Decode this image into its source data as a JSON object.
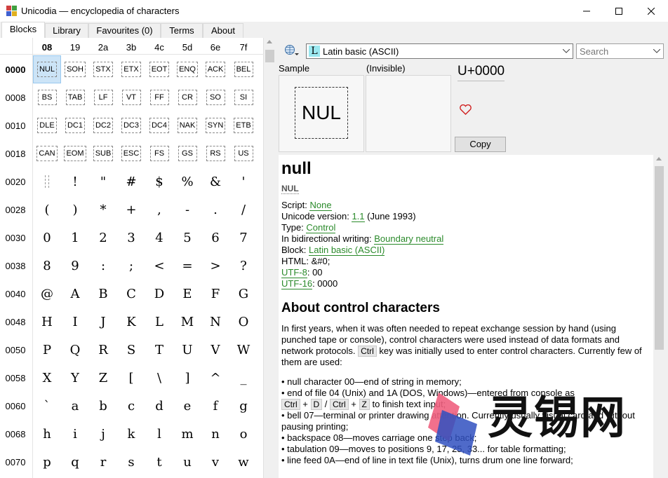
{
  "window": {
    "title": "Unicodia — encyclopedia of characters"
  },
  "tabs": [
    {
      "label": "Blocks",
      "active": true
    },
    {
      "label": "Library"
    },
    {
      "label": "Favourites (0)"
    },
    {
      "label": "Terms"
    },
    {
      "label": "About"
    }
  ],
  "grid": {
    "columns": [
      "08",
      "19",
      "2a",
      "3b",
      "4c",
      "5d",
      "6e",
      "7f"
    ],
    "rows": [
      {
        "label": "0000",
        "cells": [
          "NUL",
          "SOH",
          "STX",
          "ETX",
          "EOT",
          "ENQ",
          "ACK",
          "BEL"
        ],
        "control": true
      },
      {
        "label": "0008",
        "cells": [
          "BS",
          "TAB",
          "LF",
          "VT",
          "FF",
          "CR",
          "SO",
          "SI"
        ],
        "control": true
      },
      {
        "label": "0010",
        "cells": [
          "DLE",
          "DC1",
          "DC2",
          "DC3",
          "DC4",
          "NAK",
          "SYN",
          "ETB"
        ],
        "control": true
      },
      {
        "label": "0018",
        "cells": [
          "CAN",
          "EOM",
          "SUB",
          "ESC",
          "FS",
          "GS",
          "RS",
          "US"
        ],
        "control": true
      },
      {
        "label": "0020",
        "cells": [
          "",
          "!",
          "\"",
          "#",
          "$",
          "%",
          "&",
          "'"
        ]
      },
      {
        "label": "0028",
        "cells": [
          "(",
          ")",
          "*",
          "+",
          ",",
          "-",
          ".",
          "/"
        ]
      },
      {
        "label": "0030",
        "cells": [
          "0",
          "1",
          "2",
          "3",
          "4",
          "5",
          "6",
          "7"
        ]
      },
      {
        "label": "0038",
        "cells": [
          "8",
          "9",
          ":",
          ";",
          "<",
          "=",
          ">",
          "?"
        ]
      },
      {
        "label": "0040",
        "cells": [
          "@",
          "A",
          "B",
          "C",
          "D",
          "E",
          "F",
          "G"
        ]
      },
      {
        "label": "0048",
        "cells": [
          "H",
          "I",
          "J",
          "K",
          "L",
          "M",
          "N",
          "O"
        ]
      },
      {
        "label": "0050",
        "cells": [
          "P",
          "Q",
          "R",
          "S",
          "T",
          "U",
          "V",
          "W"
        ]
      },
      {
        "label": "0058",
        "cells": [
          "X",
          "Y",
          "Z",
          "[",
          "\\",
          "]",
          "^",
          "_"
        ]
      },
      {
        "label": "0060",
        "cells": [
          "`",
          "a",
          "b",
          "c",
          "d",
          "e",
          "f",
          "g"
        ]
      },
      {
        "label": "0068",
        "cells": [
          "h",
          "i",
          "j",
          "k",
          "l",
          "m",
          "n",
          "o"
        ]
      },
      {
        "label": "0070",
        "cells": [
          "p",
          "q",
          "r",
          "s",
          "t",
          "u",
          "v",
          "w"
        ]
      }
    ]
  },
  "toolbar": {
    "block_icon_letter": "L",
    "block": "Latin basic (ASCII)",
    "search_placeholder": "Search"
  },
  "preview": {
    "sample_label": "Sample",
    "invisible_label": "(Invisible)",
    "sample_glyph": "NUL",
    "codepoint": "U+0000",
    "copy_label": "Copy"
  },
  "info": {
    "name": "null",
    "abbr": "NUL",
    "script_label": "Script: ",
    "script": "None",
    "version_label": "Unicode version: ",
    "version": "1.1",
    "version_date": " (June 1993)",
    "type_label": "Type: ",
    "type": "Control",
    "bidi_label": "In bidirectional writing: ",
    "bidi": "Boundary neutral",
    "block_label": "Block: ",
    "block": "Latin basic (ASCII)",
    "html": "HTML: &#0;",
    "utf8_label": "UTF-8",
    "utf8": ": 00",
    "utf16_label": "UTF-16",
    "utf16": ": 0000",
    "about_title": "About control characters",
    "p1a": "In first years, when it was often needed to repeat exchange session by hand (using punched tape or console), control characters were used instead of data formats and network protocols. ",
    "ctrl": "Ctrl",
    "p1b": " key was initially used to enter control characters. Currently few of them are used:",
    "b1": "• null character 00—end of string in memory;",
    "b2": "• end of file 04 (Unix) and 1A (DOS, Windows)—entered from console as",
    "b2_k1": "Ctrl",
    "b2_plus1": " + ",
    "b2_k2": "D",
    "b2_sl": " / ",
    "b2_k3": "Ctrl",
    "b2_plus2": " + ",
    "b2_k4": "Z",
    "b2_tail": " to finish text input;",
    "b3": "• bell 07—terminal or printer drawing attention. Currently usually visual card and without pausing printing;",
    "b4": "• backspace 08—moves carriage one step back;",
    "b5": "• tabulation 09—moves to positions 9, 17, 25, 33... for table formatting;",
    "b6": "• line feed 0A—end of line in text file (Unix), turns drum one line forward;"
  },
  "watermark": {
    "text": "灵锡网"
  }
}
